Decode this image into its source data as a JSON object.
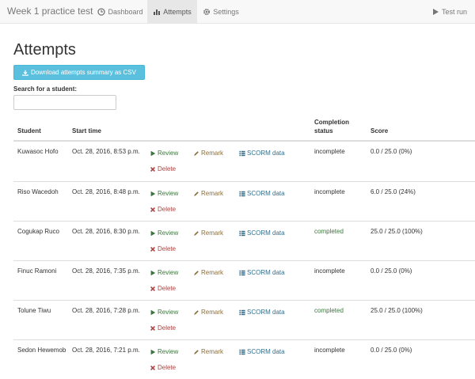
{
  "nav": {
    "brand": "Week 1 practice test",
    "tabs": [
      {
        "label": "Dashboard",
        "icon": "clock-icon",
        "active": false
      },
      {
        "label": "Attempts",
        "icon": "bar-chart-icon",
        "active": true
      },
      {
        "label": "Settings",
        "icon": "gear-icon",
        "active": false
      }
    ],
    "test_run": "Test run"
  },
  "page": {
    "title": "Attempts",
    "csv_button": "Download attempts summary as CSV",
    "search_label": "Search for a student:",
    "search_value": ""
  },
  "table": {
    "headers": {
      "student": "Student",
      "start_time": "Start time",
      "completion_status_1": "Completion",
      "completion_status_2": "status",
      "score": "Score"
    },
    "actions": {
      "review": "Review",
      "remark": "Remark",
      "scorm": "SCORM data",
      "delete": "Delete"
    },
    "rows": [
      {
        "student": "Kuwasoc Hofo",
        "start_time": "Oct. 28, 2016, 8:53 p.m.",
        "status": "incomplete",
        "score": "0.0 / 25.0 (0%)"
      },
      {
        "student": "Riso Wacedoh",
        "start_time": "Oct. 28, 2016, 8:48 p.m.",
        "status": "incomplete",
        "score": "6.0 / 25.0 (24%)"
      },
      {
        "student": "Cogukap Ruco",
        "start_time": "Oct. 28, 2016, 8:30 p.m.",
        "status": "completed",
        "score": "25.0 / 25.0 (100%)"
      },
      {
        "student": "Finuc Ramoni",
        "start_time": "Oct. 28, 2016, 7:35 p.m.",
        "status": "incomplete",
        "score": "0.0 / 25.0 (0%)"
      },
      {
        "student": "Tolune Tiwu",
        "start_time": "Oct. 28, 2016, 7:28 p.m.",
        "status": "completed",
        "score": "25.0 / 25.0 (100%)"
      },
      {
        "student": "Sedon Hewemob",
        "start_time": "Oct. 28, 2016, 7:21 p.m.",
        "status": "incomplete",
        "score": "0.0 / 25.0 (0%)"
      }
    ]
  },
  "colors": {
    "info_button": "#5bc0de",
    "success": "#3c763d",
    "warning": "#8a6d3b",
    "primary": "#31708f",
    "danger": "#a94442"
  }
}
